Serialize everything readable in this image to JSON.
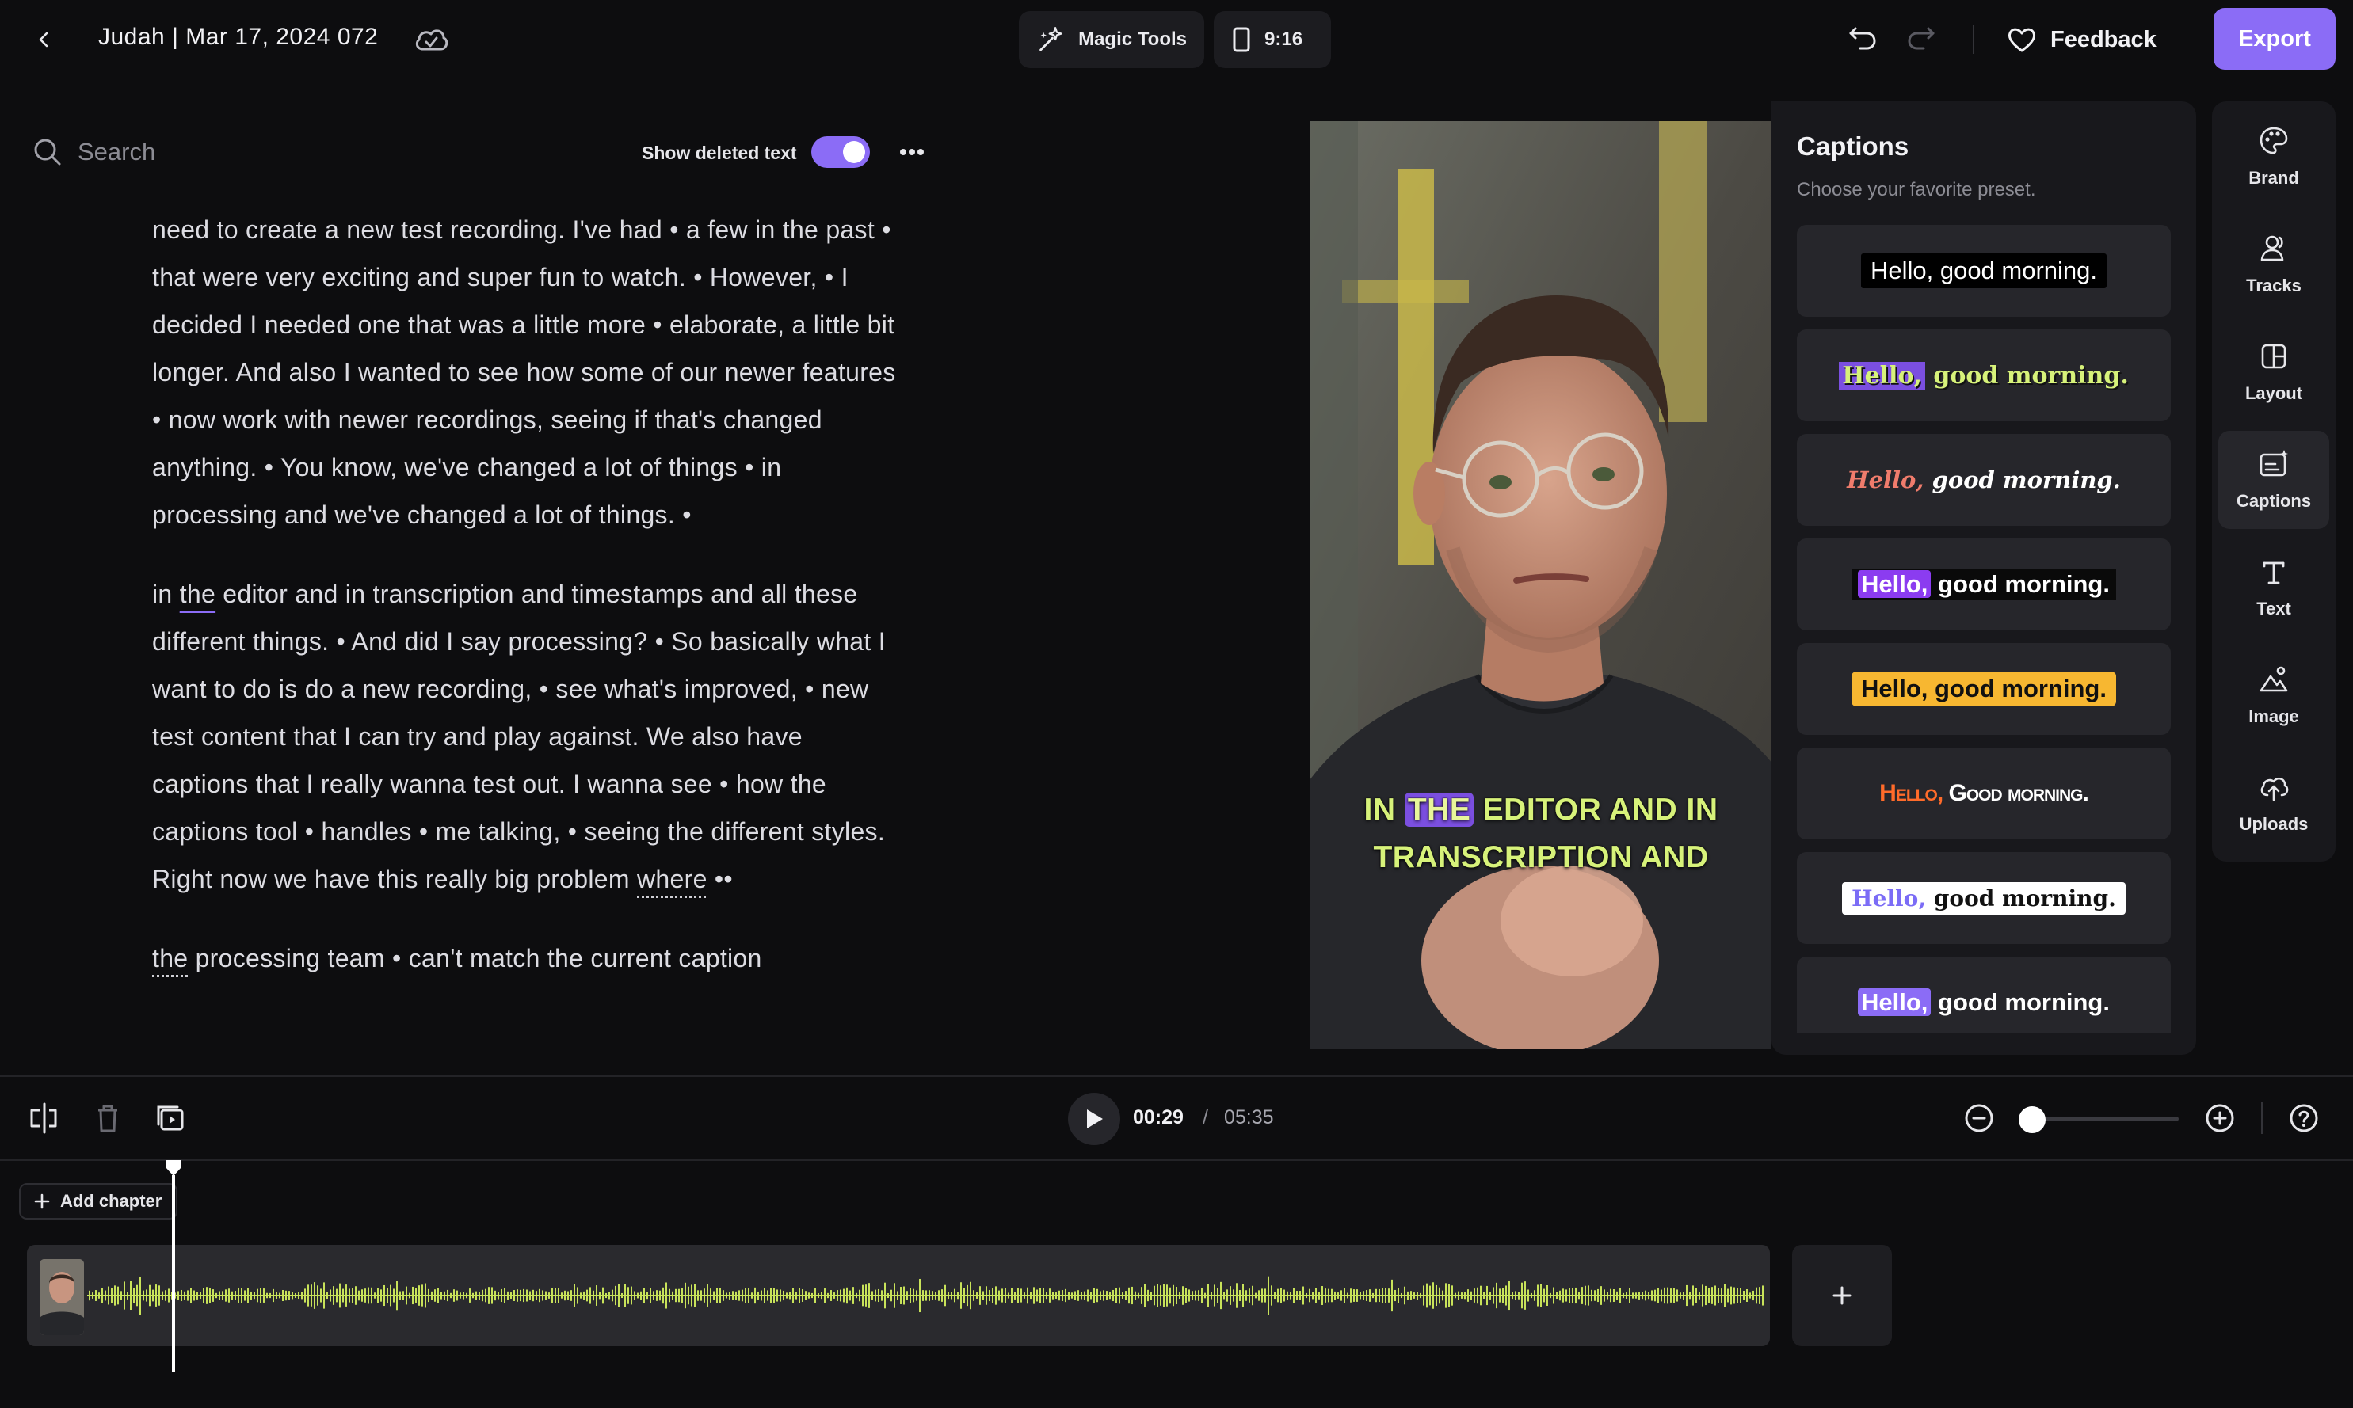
{
  "header": {
    "project_title": "Judah | Mar 17, 2024 072",
    "magic_tools_label": "Magic Tools",
    "aspect_ratio_label": "9:16",
    "feedback_label": "Feedback",
    "export_label": "Export"
  },
  "transcript": {
    "search_placeholder": "Search",
    "show_deleted_label": "Show deleted text",
    "show_deleted_enabled": true,
    "paragraphs": [
      "need to create a new test recording. I've had • a few in the past • that were very exciting and super fun to watch. • However, • I decided I needed one that was a little more • elaborate, a little bit longer. And also I wanted to see how some of our newer features • now work with newer recordings, seeing if that's changed anything. • You know, we've changed a lot of things • in processing and we've changed a lot of things. •",
      {
        "pre": "in ",
        "highlight": "the",
        "post": " editor and in transcription and timestamps and all these different things. • And did I say processing? • So basically what I want to do is do a new recording, • see what's improved, • new test content that I can try and play against. We also have captions that I really wanna test out. I wanna see • how the captions tool • handles • me talking, • seeing the different styles. Right now we have this really big problem ",
        "dotted": "where",
        "tail": " ••"
      },
      {
        "dotted": "the",
        "post": " processing team • can't match the current caption"
      }
    ]
  },
  "preview": {
    "caption_line1_pre": "IN ",
    "caption_line1_highlight": "THE",
    "caption_line1_post": " EDITOR AND IN",
    "caption_line2": "TRANSCRIPTION AND"
  },
  "captions_panel": {
    "title": "Captions",
    "subtitle": "Choose your favorite preset.",
    "presets": [
      {
        "first": "Hello,",
        "rest": " good morning."
      },
      {
        "first": "Hello,",
        "rest": " good morning."
      },
      {
        "first": "Hello,",
        "rest": " good morning."
      },
      {
        "first": "Hello,",
        "rest": " good morning."
      },
      {
        "first": "Hello,",
        "rest": " good morning."
      },
      {
        "first": "Hello,",
        "rest": " Good morning."
      },
      {
        "first": "Hello,",
        "rest": " good morning."
      },
      {
        "first": "Hello,",
        "rest": " good morning."
      }
    ]
  },
  "tools": [
    {
      "label": "Brand",
      "icon": "palette-icon"
    },
    {
      "label": "Tracks",
      "icon": "users-icon"
    },
    {
      "label": "Layout",
      "icon": "layout-icon"
    },
    {
      "label": "Captions",
      "icon": "captions-icon",
      "active": true
    },
    {
      "label": "Text",
      "icon": "text-icon"
    },
    {
      "label": "Image",
      "icon": "image-icon"
    },
    {
      "label": "Uploads",
      "icon": "upload-icon"
    }
  ],
  "playback": {
    "current_time": "00:29",
    "separator": "/",
    "total_time": "05:35",
    "zoom_level": 0
  },
  "timeline": {
    "add_chapter_label": "Add chapter"
  },
  "colors": {
    "accent": "#8b6cf6",
    "waveform": "#c8e25a",
    "caption_text": "#d7f27a",
    "background": "#0d0d0f"
  }
}
